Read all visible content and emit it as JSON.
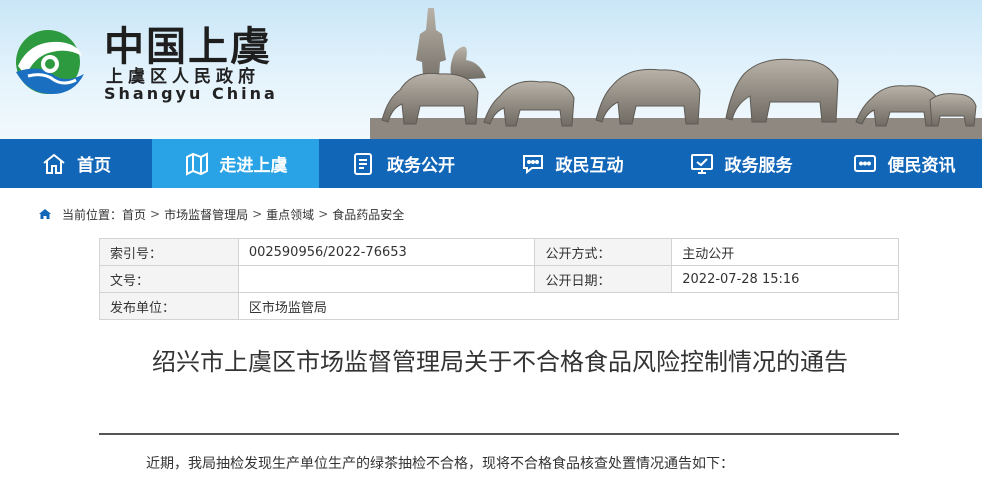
{
  "header": {
    "logo_cn": "中国上虞",
    "logo_gov": "上虞区人民政府",
    "logo_en": "Shangyu China"
  },
  "nav": {
    "items": [
      {
        "label": "首页",
        "icon": "home-icon"
      },
      {
        "label": "走进上虞",
        "icon": "map-icon"
      },
      {
        "label": "政务公开",
        "icon": "document-icon"
      },
      {
        "label": "政民互动",
        "icon": "chat-icon"
      },
      {
        "label": "政务服务",
        "icon": "monitor-icon"
      },
      {
        "label": "便民资讯",
        "icon": "message-icon"
      }
    ],
    "active_index": 1
  },
  "breadcrumb": {
    "prefix": "当前位置：",
    "items": [
      "首页",
      "市场监督管理局",
      "重点领域",
      "食品药品安全"
    ],
    "separator": ">"
  },
  "info": {
    "index_label": "索引号：",
    "index_value": "002590956/2022-76653",
    "method_label": "公开方式：",
    "method_value": "主动公开",
    "docno_label": "文号：",
    "docno_value": "",
    "date_label": "公开日期：",
    "date_value": "2022-07-28 15:16",
    "publisher_label": "发布单位：",
    "publisher_value": "区市场监管局"
  },
  "article": {
    "title": "绍兴市上虞区市场监督管理局关于不合格食品风险控制情况的通告",
    "intro": "近期，我局抽检发现生产单位生产的绿茶抽检不合格，现将不合格食品核查处置情况通告如下："
  },
  "colors": {
    "nav_bg": "#1166b8",
    "nav_active": "#2aa3e6",
    "logo_green": "#2e9a3f",
    "logo_blue": "#1a6fc0"
  }
}
